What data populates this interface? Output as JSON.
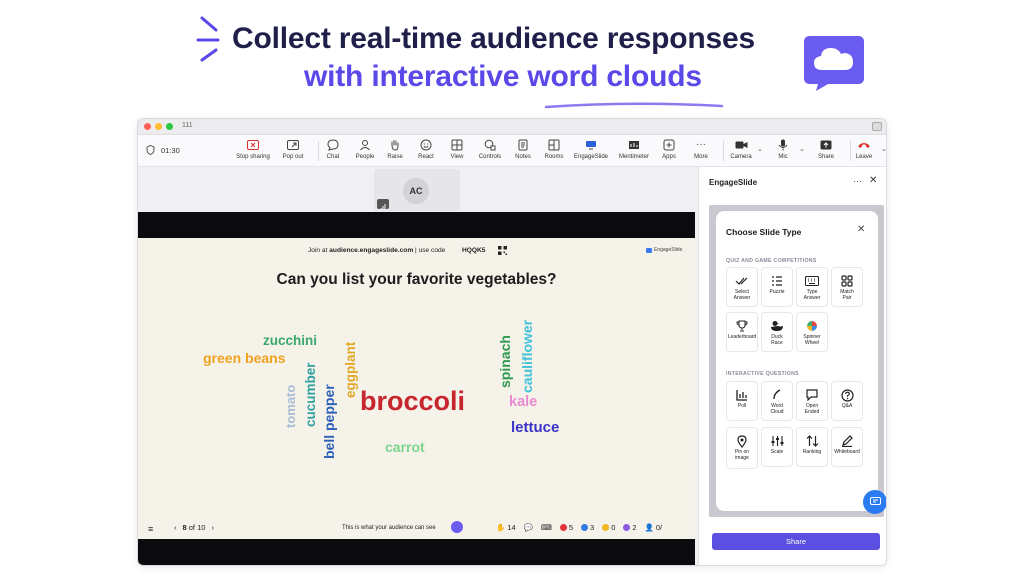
{
  "hero": {
    "line1": "Collect real-time audience responses",
    "line2": "with interactive word clouds",
    "accent_color": "#5a48e8",
    "dark_color": "#1f1f4a",
    "badge_icon": "cloud-chat-icon"
  },
  "window": {
    "title": "111",
    "meeting_timer": "01:30",
    "toolbar": {
      "stop_sharing": "Stop sharing",
      "pop_out": "Pop out",
      "chat": "Chat",
      "people": "People",
      "raise": "Raise",
      "react": "React",
      "view": "View",
      "controls": "Controls",
      "notes": "Notes",
      "rooms": "Rooms",
      "engageslide": "EngageSlide",
      "mentimeter": "Mentimeter",
      "apps": "Apps",
      "more": "More",
      "camera": "Camera",
      "mic": "Mic",
      "share": "Share",
      "leave": "Leave"
    }
  },
  "participant": {
    "initials": "AC"
  },
  "slide": {
    "join_prefix": "Join at ",
    "join_url": "audience.engageslide.com",
    "join_suffix": " | use code",
    "join_code": "HQQK5",
    "logo_text": "EngageSlide",
    "question": "Can you list your favorite vegetables?",
    "words": [
      {
        "text": "zucchini",
        "color": "#3aa86b"
      },
      {
        "text": "green beans",
        "color": "#f0a21e"
      },
      {
        "text": "tomato",
        "color": "#a9bcd6"
      },
      {
        "text": "cucumber",
        "color": "#2fa0a0"
      },
      {
        "text": "bell pepper",
        "color": "#2b5fb8"
      },
      {
        "text": "eggplant",
        "color": "#e2a826"
      },
      {
        "text": "broccoli",
        "color": "#c8262e"
      },
      {
        "text": "spinach",
        "color": "#2e9a4e"
      },
      {
        "text": "cauliflower",
        "color": "#3fc2d8"
      },
      {
        "text": "kale",
        "color": "#e98bd0"
      },
      {
        "text": "lettuce",
        "color": "#3a32c8"
      },
      {
        "text": "carrot",
        "color": "#7cd68a"
      }
    ],
    "footer": {
      "page_current": "8",
      "page_of": "of 10",
      "audience_note": "This is what your audience can see",
      "stats": {
        "hands": "14",
        "comments": "",
        "hearts": "5",
        "thumbs": "3",
        "laugh": "0",
        "wow": "2",
        "people": "0/"
      }
    }
  },
  "panel": {
    "title": "EngageSlide",
    "card_title": "Choose Slide Type",
    "section_quiz": "QUIZ AND GAME COMPETITIONS",
    "section_interactive": "INTERACTIVE QUESTIONS",
    "quiz_types": [
      {
        "label": "Select\nAnswer",
        "icon": "double-check-icon"
      },
      {
        "label": "Puzzle",
        "icon": "list-order-icon"
      },
      {
        "label": "Type\nAnswer",
        "icon": "keyboard-icon"
      },
      {
        "label": "Match\nPair",
        "icon": "grid-pair-icon"
      },
      {
        "label": "Leaderboard",
        "icon": "trophy-icon"
      },
      {
        "label": "Duck\nRace",
        "icon": "duck-icon"
      },
      {
        "label": "Spinner\nWheel",
        "icon": "spinner-wheel-icon"
      }
    ],
    "interactive_types": [
      {
        "label": "Poll",
        "icon": "bar-chart-icon"
      },
      {
        "label": "Word\nCloud",
        "icon": "word-cloud-icon"
      },
      {
        "label": "Open\nEnded",
        "icon": "speech-bubble-icon"
      },
      {
        "label": "Q&A",
        "icon": "question-circle-icon"
      },
      {
        "label": "Pin on\nimage",
        "icon": "pin-icon"
      },
      {
        "label": "Scale",
        "icon": "sliders-icon"
      },
      {
        "label": "Ranking",
        "icon": "sort-arrows-icon"
      },
      {
        "label": "Whiteboard",
        "icon": "pen-icon"
      }
    ],
    "share_label": "Share",
    "share_color": "#5a4fe0"
  }
}
